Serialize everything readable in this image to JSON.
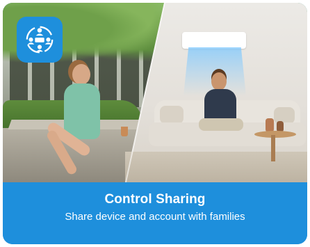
{
  "card": {
    "icon": "people-sharing-icon",
    "title": "Control Sharing",
    "subtitle": "Share device and account with families"
  },
  "colors": {
    "brand_blue": "#1e8fdc",
    "text": "#ffffff"
  }
}
